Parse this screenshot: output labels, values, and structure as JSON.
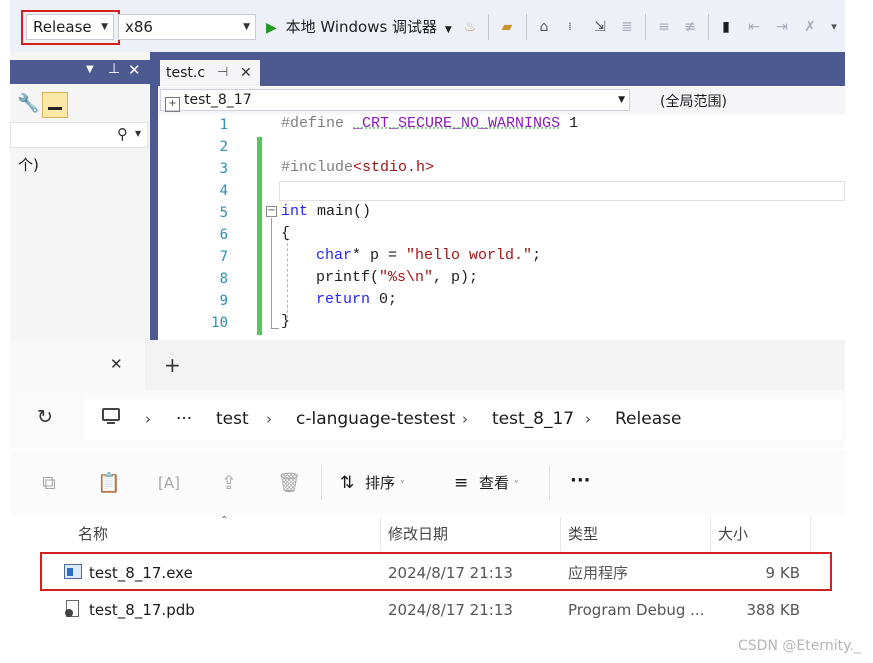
{
  "toolbar": {
    "config": "Release",
    "platform": "x86",
    "debugger_label": "本地 Windows 调试器"
  },
  "editor": {
    "tab_title": "test.c",
    "tab_pin": "⊤",
    "tab_close": "✕",
    "nav_scope": "test_8_17",
    "nav_member": "(全局范围)",
    "line_numbers": [
      "1",
      "2",
      "3",
      "4",
      "5",
      "6",
      "7",
      "8",
      "9",
      "10"
    ],
    "code": {
      "l1_kw": "#define",
      "l1_macro": "_CRT_SECURE_NO_WARNINGS",
      "l1_val": " 1",
      "l3_kw": "#include",
      "l3_inc": "<stdio.h>",
      "l5_type": "int",
      "l5_rest": " main()",
      "l6": "{",
      "l7_type": "char",
      "l7_mid": "* p = ",
      "l7_str": "\"hello world.\"",
      "l7_end": ";",
      "l8_fn": "printf(",
      "l8_str": "\"%s\\n\"",
      "l8_end": ", p);",
      "l9_kw": "return",
      "l9_end": " 0;",
      "l10": "}"
    }
  },
  "left_panel": {
    "text": "个)",
    "pin": "ㅁ",
    "close": "✕"
  },
  "explorer": {
    "tab_close": "✕",
    "new_tab": "+",
    "breadcrumb": [
      "test",
      "c-language-testest",
      "test_8_17",
      "Release"
    ],
    "ellipsis": "···",
    "commands": {
      "sort": "排序",
      "view": "查看",
      "more": "···"
    },
    "columns": {
      "name": "名称",
      "modified": "修改日期",
      "type": "类型",
      "size": "大小"
    },
    "files": [
      {
        "name": "test_8_17.exe",
        "modified": "2024/8/17 21:13",
        "type": "应用程序",
        "size": "9 KB"
      },
      {
        "name": "test_8_17.pdb",
        "modified": "2024/8/17 21:13",
        "type": "Program Debug ...",
        "size": "388 KB"
      }
    ]
  },
  "watermark": "CSDN @Eternity._"
}
